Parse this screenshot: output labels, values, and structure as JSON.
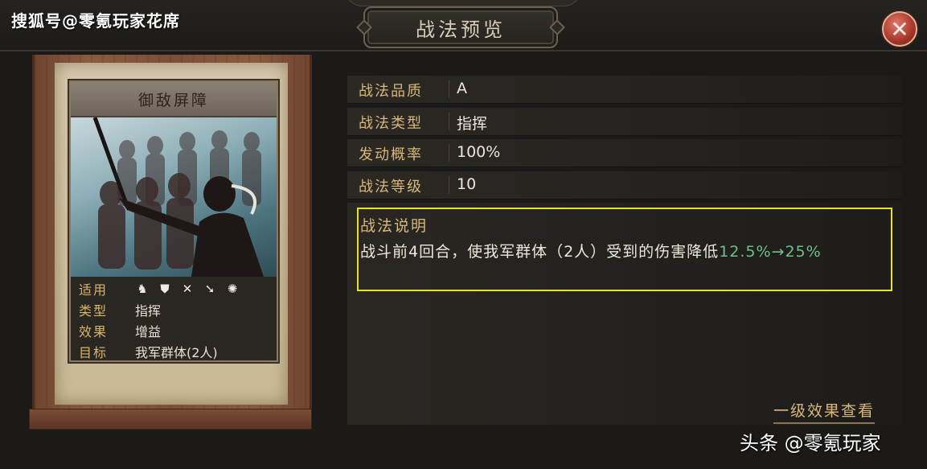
{
  "watermark_top": "搜狐号@零氪玩家花席",
  "watermark_bottom": "头条 @零氪玩家",
  "window": {
    "title": "战法预览",
    "close_icon": "close-icon"
  },
  "card": {
    "name": "御敌屏障",
    "rows": [
      {
        "key": "适用",
        "icons": [
          "cavalry-icon",
          "shield-icon",
          "bow-icon",
          "spear-icon",
          "chariot-icon"
        ]
      },
      {
        "key": "类型",
        "value": "指挥"
      },
      {
        "key": "效果",
        "value": "增益"
      },
      {
        "key": "目标",
        "value": "我军群体(2人)"
      }
    ]
  },
  "stats": [
    {
      "key": "战法品质",
      "value": "A"
    },
    {
      "key": "战法类型",
      "value": "指挥"
    },
    {
      "key": "发动概率",
      "value": "100%"
    },
    {
      "key": "战法等级",
      "value": "10"
    }
  ],
  "description": {
    "title": "战法说明",
    "text_before": "战斗前4回合，使我军群体（2人）受到的伤害降低",
    "highlight": "12.5%→25%"
  },
  "level_link": "一级效果查看",
  "colors": {
    "gold": "#d7b77a",
    "highlight_green": "#6fc08a",
    "annotation_yellow": "#e8e41e",
    "close_red": "#a8352a"
  }
}
